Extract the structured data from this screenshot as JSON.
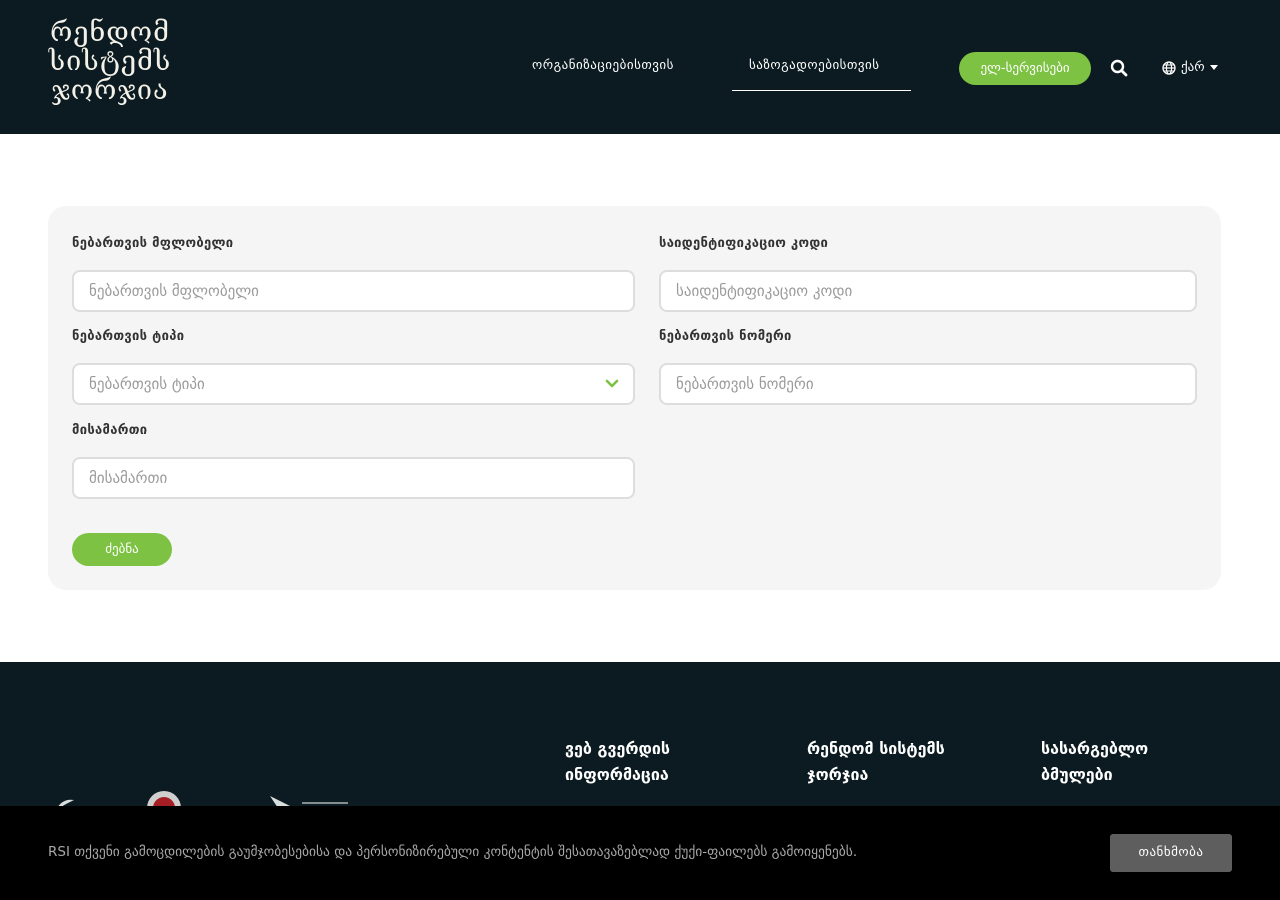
{
  "header": {
    "logo_lines": [
      "რენდომ",
      "სისტემს",
      "ჯორჯია"
    ],
    "nav": {
      "organizations": "ორგანიზაციებისთვის",
      "society": "საზოგადოებისთვის"
    },
    "eservices_label": "ელ-სერვისები",
    "language_label": "ქარ"
  },
  "search_form": {
    "owner": {
      "label": "ნებართვის მფლობელი",
      "placeholder": "ნებართვის მფლობელი"
    },
    "id_code": {
      "label": "საიდენტიფიკაციო კოდი",
      "placeholder": "საიდენტიფიკაციო კოდი"
    },
    "permit_type": {
      "label": "ნებართვის ტიპი",
      "placeholder": "ნებართვის ტიპი"
    },
    "permit_number": {
      "label": "ნებართვის ნომერი",
      "placeholder": "ნებართვის ნომერი"
    },
    "address": {
      "label": "მისამართი",
      "placeholder": "მისამართი"
    },
    "submit_label": "ძებნა"
  },
  "footer": {
    "columns": [
      {
        "line1": "ვებ გვერდის",
        "line2": "ინფორმაცია"
      },
      {
        "line1": "რენდომ სისტემს",
        "line2": "ჯორჯია"
      },
      {
        "line1": "სასარგებლო",
        "line2": "ბმულები"
      }
    ]
  },
  "cookie": {
    "text": "RSI თქვენი გამოცდილების გაუმჯობესებისა და პერსონიზირებული კონტენტის შესათავაზებლად ქუქი-ფაილებს გამოიყენებს.",
    "accept_label": "თანხმობა"
  },
  "colors": {
    "header_bg": "#0b1b21",
    "accent": "#7dc242",
    "panel_bg": "#f5f5f5"
  }
}
